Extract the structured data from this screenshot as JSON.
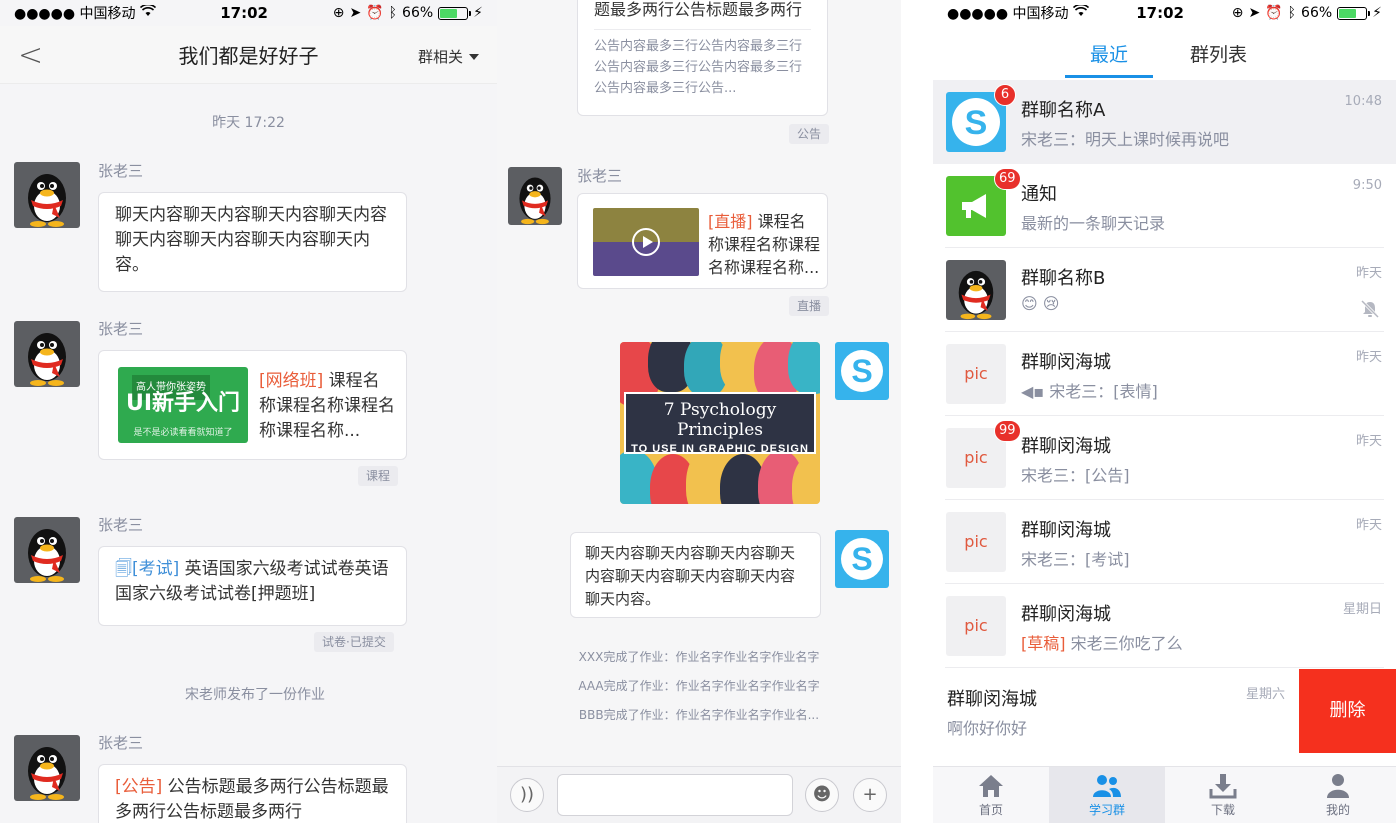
{
  "status": {
    "carrier": "●●●●● 中国移动",
    "time": "17:02",
    "battery": "66%",
    "battery_level": 0.66
  },
  "panel1": {
    "nav": {
      "back_label": "<",
      "title": "我们都是好好子",
      "group_menu": "群相关"
    },
    "time_label": "昨天 17:22",
    "messages": [
      {
        "sender": "张老三",
        "text": "聊天内容聊天内容聊天内容聊天内容聊天内容聊天内容聊天内容聊天内容。"
      },
      {
        "sender": "张老三",
        "prefix": "[网络班]",
        "text": "课程名称课程名称课程名称课程名称...",
        "tag": "课程",
        "thumb": {
          "top": "高人带你张姿势",
          "main": "UI新手入门",
          "sub": "是不是必读看看就知道了"
        }
      },
      {
        "sender": "张老三",
        "prefix": "[考试]",
        "text": "英语国家六级考试试卷英语国家六级考试试卷[押题班]",
        "tag": "试卷·已提交"
      },
      {
        "sender": "张老三",
        "prefix": "[公告]",
        "text": "公告标题最多两行公告标题最多两行公告标题最多两行"
      }
    ],
    "system_note": "宋老师发布了一份作业"
  },
  "panel2": {
    "notice": {
      "title_tail": "题最多两行公告标题最多两行",
      "body": "公告内容最多三行公告内容最多三行公告内容最多三行公告内容最多三行公告内容最多三行公告...",
      "tag": "公告"
    },
    "live_msg": {
      "sender": "张老三",
      "prefix": "[直播]",
      "text": "课程名称课程名称课程名称课程名称...",
      "tag": "直播"
    },
    "poster": {
      "line1": "7 Psychology Principles",
      "line2": "TO USE IN GRAPHIC DESIGN"
    },
    "self_msg": "聊天内容聊天内容聊天内容聊天内容聊天内容聊天内容聊天内容聊天内容。",
    "homework": [
      "XXX完成了作业：作业名字作业名字作业名字",
      "AAA完成了作业：作业名字作业名字作业名字",
      "BBB完成了作业：作业名字作业名字作业名..."
    ],
    "composer": {
      "voice_icon": "))",
      "emoji_icon": "☻",
      "add_icon": "+"
    }
  },
  "panel3": {
    "tabs": [
      "最近",
      "群列表"
    ],
    "rows": [
      {
        "name": "群聊名称A",
        "msg": "宋老三：明天上课时候再说吧",
        "time": "10:48",
        "badge": "6",
        "avatar": "skype"
      },
      {
        "name": "通知",
        "msg": "最新的一条聊天记录",
        "time": "9:50",
        "badge": "69",
        "avatar": "notice"
      },
      {
        "name": "群聊名称B",
        "msg": "😊 😢",
        "time": "昨天",
        "avatar": "penguin",
        "muted": true
      },
      {
        "name": "群聊闵海城",
        "msg": "宋老三：[表情]",
        "time": "昨天",
        "avatar": "pic",
        "pic_label": "pic",
        "reply_icon": true
      },
      {
        "name": "群聊闵海城",
        "msg": "宋老三：[公告]",
        "time": "昨天",
        "badge": "99",
        "avatar": "pic",
        "pic_label": "pic"
      },
      {
        "name": "群聊闵海城",
        "msg": "宋老三：[考试]",
        "time": "昨天",
        "avatar": "pic",
        "pic_label": "pic"
      },
      {
        "name": "群聊闵海城",
        "draft": "[草稿]",
        "msg": "宋老三你吃了么",
        "time": "星期日",
        "avatar": "pic",
        "pic_label": "pic"
      },
      {
        "name": "群聊闵海城",
        "msg": "啊你好你好",
        "time": "星期六",
        "avatar": "none"
      }
    ],
    "delete_label": "删除",
    "tabbar": [
      {
        "label": "首页",
        "icon": "home-icon"
      },
      {
        "label": "学习群",
        "icon": "group-icon",
        "active": true
      },
      {
        "label": "下载",
        "icon": "download-icon"
      },
      {
        "label": "我的",
        "icon": "profile-icon"
      }
    ]
  },
  "colors": {
    "accent": "#1990e6",
    "badge": "#e8302a",
    "delete": "#f5301e",
    "tag_red": "#e95d3a"
  }
}
